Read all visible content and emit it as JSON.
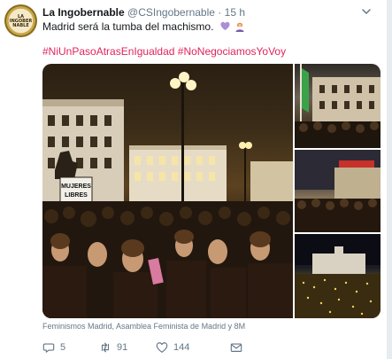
{
  "tweet": {
    "author_name": "La Ingobernable",
    "handle": "@CSIngobernable",
    "separator": "·",
    "time": "15 h",
    "text": "Madrid será la tumba del machismo.",
    "hashtags": [
      "#NiUnPasoAtrasEnIgualdad",
      "#NoNegociamosYoVoy"
    ],
    "avatar_text": [
      "LA",
      "INGOBER",
      "NABLE"
    ]
  },
  "media": {
    "sign_text": [
      "MUJERES",
      "LIBRES"
    ],
    "caption": "Feminismos Madrid, Asamblea Feminista de Madrid y 8M"
  },
  "actions": {
    "replies": "5",
    "retweets": "91",
    "likes": "144"
  },
  "colors": {
    "hashtag": "#e0245e",
    "muted": "#657786",
    "text": "#14171a",
    "heart_emoji": "#aa8ed6"
  },
  "icons": [
    "caret-down-icon",
    "purple-heart-icon",
    "person-emoji-icon",
    "reply-icon",
    "retweet-icon",
    "like-icon",
    "direct-message-icon"
  ]
}
